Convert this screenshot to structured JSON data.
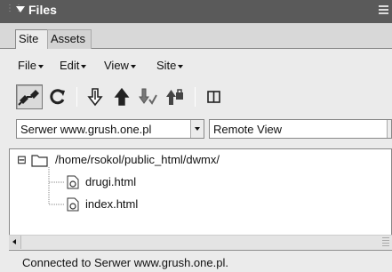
{
  "panel": {
    "title": "Files",
    "colors": {
      "titlebar": "#5a5a5a",
      "background": "#ebebeb"
    }
  },
  "tabs": [
    {
      "label": "Site",
      "active": true
    },
    {
      "label": "Assets",
      "active": false
    }
  ],
  "menus": [
    {
      "label": "File"
    },
    {
      "label": "Edit"
    },
    {
      "label": "View"
    },
    {
      "label": "Site"
    }
  ],
  "toolbar": {
    "icons": [
      "connect-icon",
      "refresh-icon",
      "get-files-icon",
      "put-files-icon",
      "check-out-icon",
      "check-in-icon",
      "expand-icon"
    ]
  },
  "site_select": {
    "value": "Serwer www.grush.one.pl"
  },
  "view_select": {
    "value": "Remote View"
  },
  "tree": {
    "root": {
      "path": "/home/rsokol/public_html/dwmx/",
      "expander": "⊟"
    },
    "files": [
      {
        "name": "drugi.html"
      },
      {
        "name": "index.html"
      }
    ]
  },
  "status": {
    "text": "Connected to Serwer www.grush.one.pl."
  }
}
